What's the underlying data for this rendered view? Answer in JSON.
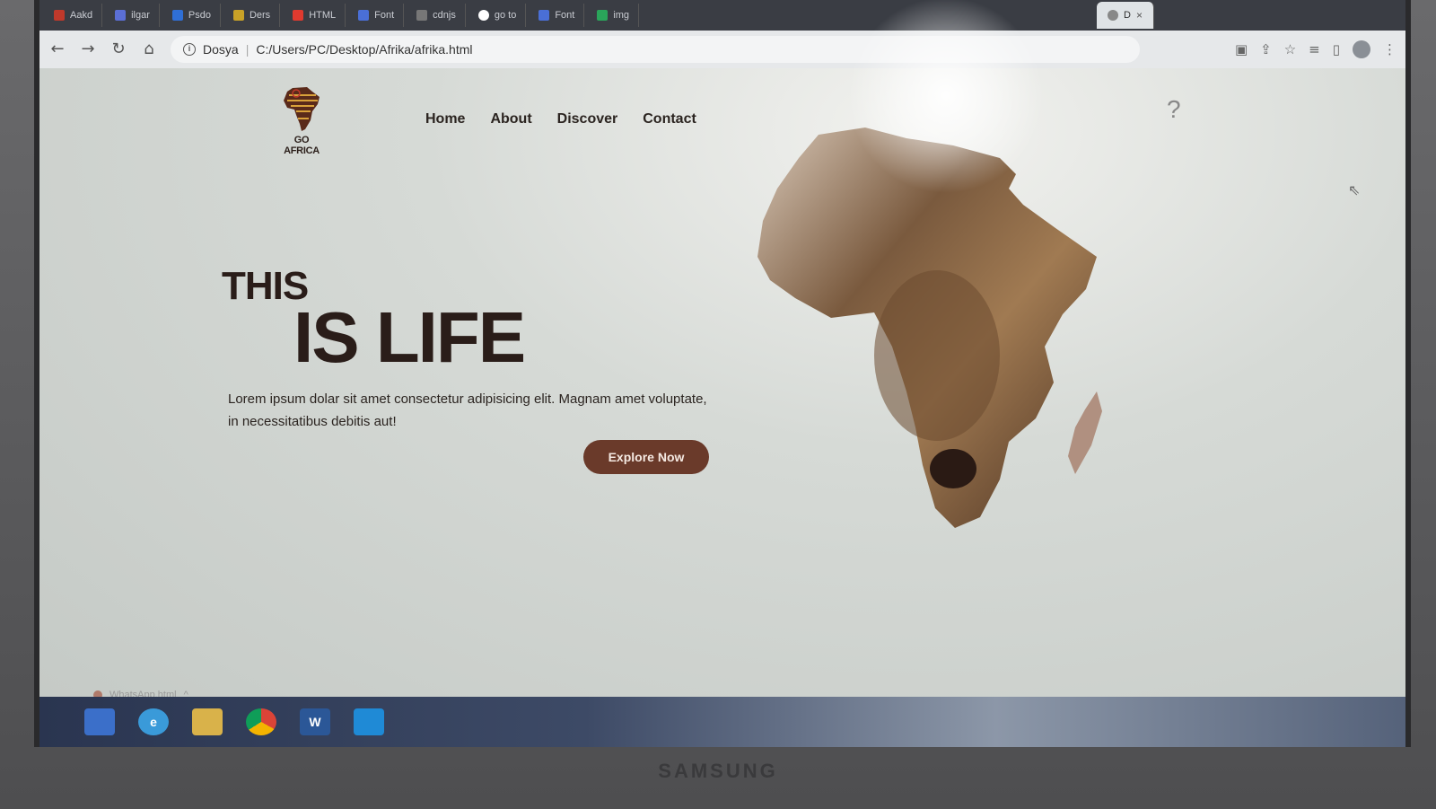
{
  "browser": {
    "tabs": [
      {
        "label": "Aakd",
        "color": "#c0392b"
      },
      {
        "label": "ilgar",
        "color": "#5b6fd6"
      },
      {
        "label": "Psdo",
        "color": "#2f6fd6"
      },
      {
        "label": "Ders",
        "color": "#c9a227"
      },
      {
        "label": "HTML",
        "color": "#e03a2f"
      },
      {
        "label": "Font",
        "color": "#4a6fd6"
      },
      {
        "label": "cdnjs",
        "color": "#777777"
      },
      {
        "label": "go to",
        "color": "#ffffff"
      },
      {
        "label": "Font",
        "color": "#4a6fd6"
      },
      {
        "label": "img",
        "color": "#2aa55a"
      }
    ],
    "active_tab": {
      "label": "D",
      "close": "×"
    },
    "address": {
      "scheme_label": "Dosya",
      "url": "C:/Users/PC/Desktop/Afrika/afrika.html"
    }
  },
  "site": {
    "logo": {
      "line1": "GO",
      "line2": "AFRICA"
    },
    "nav": [
      "Home",
      "About",
      "Discover",
      "Contact"
    ],
    "help": "?",
    "hero": {
      "line1": "THIS",
      "line2": "IS LIFE",
      "text": "Lorem ipsum dolar sit amet consectetur adipisicing elit. Magnam amet voluptate, in necessitatibus debitis aut!",
      "button": "Explore Now"
    }
  },
  "download": {
    "file": "WhatsApp.html"
  },
  "taskbar": {
    "word_label": "W"
  },
  "hardware": {
    "brand": "SAMSUNG"
  },
  "colors": {
    "accent": "#6a3a2a",
    "heading": "#2a1d19"
  }
}
